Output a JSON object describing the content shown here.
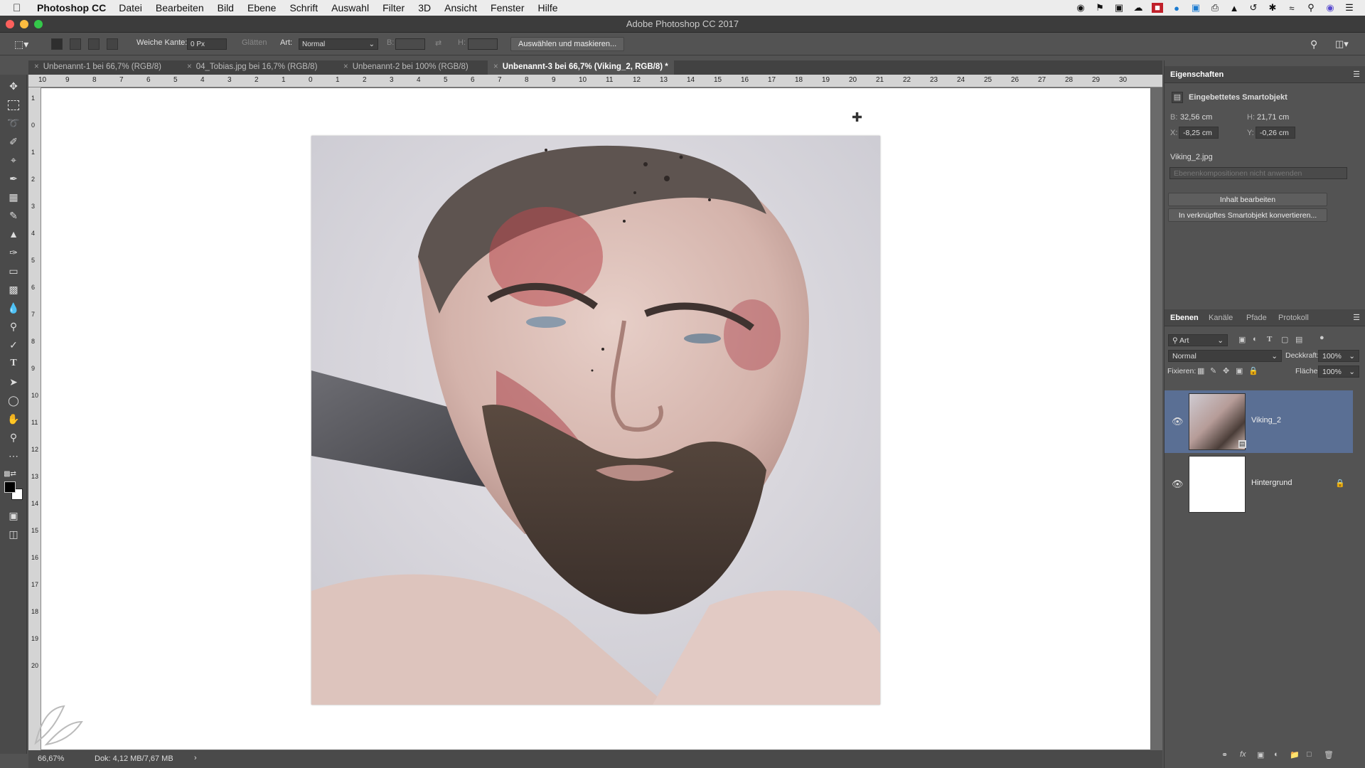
{
  "menubar": {
    "app": "Photoshop CC",
    "items": [
      "Datei",
      "Bearbeiten",
      "Bild",
      "Ebene",
      "Schrift",
      "Auswahl",
      "Filter",
      "3D",
      "Ansicht",
      "Fenster",
      "Hilfe"
    ]
  },
  "window": {
    "title": "Adobe Photoshop CC 2017"
  },
  "options": {
    "soft_edge_label": "Weiche Kante:",
    "soft_edge_value": "0 Px",
    "antialias_label": "Glätten",
    "style_label": "Art:",
    "style_value": "Normal",
    "width_label": "B:",
    "height_label": "H:",
    "select_mask_button": "Auswählen und maskieren..."
  },
  "tabs": [
    {
      "label": "Unbenannt-1 bei 66,7% (RGB/8)"
    },
    {
      "label": "04_Tobias.jpg bei 16,7% (RGB/8)"
    },
    {
      "label": "Unbenannt-2 bei 100% (RGB/8)"
    },
    {
      "label": "Unbenannt-3 bei 66,7% (Viking_2, RGB/8) *"
    }
  ],
  "ruler": {
    "h_labels": [
      "10",
      "9",
      "8",
      "7",
      "6",
      "5",
      "4",
      "3",
      "2",
      "1",
      "0",
      "1",
      "2",
      "3",
      "4",
      "5",
      "6",
      "7",
      "8",
      "9",
      "10",
      "11",
      "12",
      "13",
      "14",
      "15",
      "16",
      "17",
      "18",
      "19",
      "20",
      "21",
      "22",
      "23",
      "24",
      "25",
      "26",
      "27",
      "28",
      "29",
      "30"
    ],
    "v_labels": [
      "1",
      "0",
      "1",
      "2",
      "3",
      "4",
      "5",
      "6",
      "7",
      "8",
      "9",
      "10",
      "11",
      "12",
      "13",
      "14",
      "15",
      "16",
      "17",
      "18",
      "19",
      "20"
    ]
  },
  "status": {
    "zoom": "66,67%",
    "doc": "Dok: 4,12 MB/7,67 MB"
  },
  "properties": {
    "title": "Eigenschaften",
    "object_type": "Eingebettetes Smartobjekt",
    "w_label": "B:",
    "w_value": "32,56 cm",
    "h_label": "H:",
    "h_value": "21,71 cm",
    "x_label": "X:",
    "x_value": "-8,25 cm",
    "y_label": "Y:",
    "y_value": "-0,26 cm",
    "filename": "Viking_2.jpg",
    "comp_placeholder": "Ebenenkompositionen nicht anwenden",
    "edit_button": "Inhalt bearbeiten",
    "convert_button": "In verknüpftes Smartobjekt konvertieren..."
  },
  "layers_panel": {
    "tabs": [
      "Ebenen",
      "Kanäle",
      "Pfade",
      "Protokoll"
    ],
    "filter_value": "Art",
    "blend_mode": "Normal",
    "opacity_label": "Deckkraft:",
    "opacity_value": "100%",
    "lock_label": "Fixieren:",
    "fill_label": "Fläche:",
    "fill_value": "100%",
    "layers": [
      {
        "name": "Viking_2",
        "selected": true
      },
      {
        "name": "Hintergrund",
        "selected": false
      }
    ]
  },
  "colors": {
    "accent_selected_layer": "#5a6f94",
    "canvas_bg": "#ffffff"
  }
}
